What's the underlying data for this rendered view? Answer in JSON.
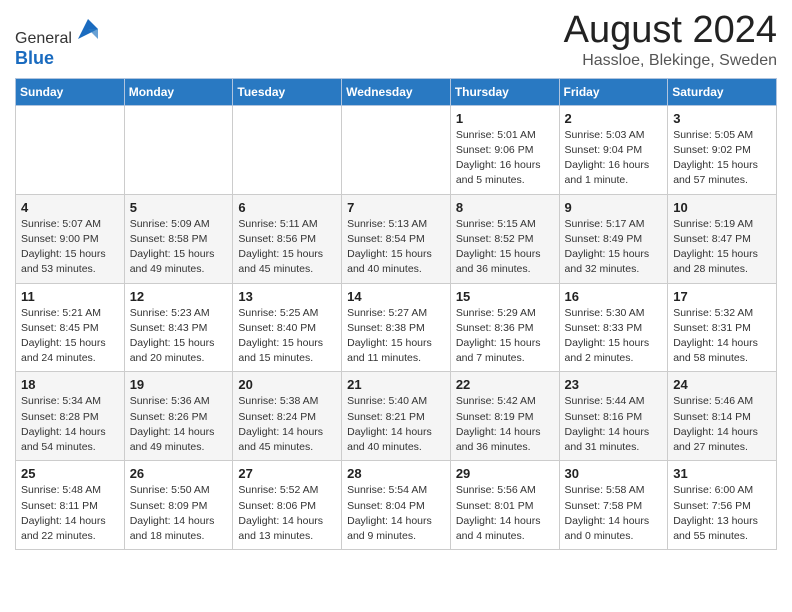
{
  "header": {
    "logo_line1": "General",
    "logo_line2": "Blue",
    "month_title": "August 2024",
    "location": "Hassloe, Blekinge, Sweden"
  },
  "weekdays": [
    "Sunday",
    "Monday",
    "Tuesday",
    "Wednesday",
    "Thursday",
    "Friday",
    "Saturday"
  ],
  "weeks": [
    [
      {
        "day": "",
        "info": ""
      },
      {
        "day": "",
        "info": ""
      },
      {
        "day": "",
        "info": ""
      },
      {
        "day": "",
        "info": ""
      },
      {
        "day": "1",
        "info": "Sunrise: 5:01 AM\nSunset: 9:06 PM\nDaylight: 16 hours\nand 5 minutes."
      },
      {
        "day": "2",
        "info": "Sunrise: 5:03 AM\nSunset: 9:04 PM\nDaylight: 16 hours\nand 1 minute."
      },
      {
        "day": "3",
        "info": "Sunrise: 5:05 AM\nSunset: 9:02 PM\nDaylight: 15 hours\nand 57 minutes."
      }
    ],
    [
      {
        "day": "4",
        "info": "Sunrise: 5:07 AM\nSunset: 9:00 PM\nDaylight: 15 hours\nand 53 minutes."
      },
      {
        "day": "5",
        "info": "Sunrise: 5:09 AM\nSunset: 8:58 PM\nDaylight: 15 hours\nand 49 minutes."
      },
      {
        "day": "6",
        "info": "Sunrise: 5:11 AM\nSunset: 8:56 PM\nDaylight: 15 hours\nand 45 minutes."
      },
      {
        "day": "7",
        "info": "Sunrise: 5:13 AM\nSunset: 8:54 PM\nDaylight: 15 hours\nand 40 minutes."
      },
      {
        "day": "8",
        "info": "Sunrise: 5:15 AM\nSunset: 8:52 PM\nDaylight: 15 hours\nand 36 minutes."
      },
      {
        "day": "9",
        "info": "Sunrise: 5:17 AM\nSunset: 8:49 PM\nDaylight: 15 hours\nand 32 minutes."
      },
      {
        "day": "10",
        "info": "Sunrise: 5:19 AM\nSunset: 8:47 PM\nDaylight: 15 hours\nand 28 minutes."
      }
    ],
    [
      {
        "day": "11",
        "info": "Sunrise: 5:21 AM\nSunset: 8:45 PM\nDaylight: 15 hours\nand 24 minutes."
      },
      {
        "day": "12",
        "info": "Sunrise: 5:23 AM\nSunset: 8:43 PM\nDaylight: 15 hours\nand 20 minutes."
      },
      {
        "day": "13",
        "info": "Sunrise: 5:25 AM\nSunset: 8:40 PM\nDaylight: 15 hours\nand 15 minutes."
      },
      {
        "day": "14",
        "info": "Sunrise: 5:27 AM\nSunset: 8:38 PM\nDaylight: 15 hours\nand 11 minutes."
      },
      {
        "day": "15",
        "info": "Sunrise: 5:29 AM\nSunset: 8:36 PM\nDaylight: 15 hours\nand 7 minutes."
      },
      {
        "day": "16",
        "info": "Sunrise: 5:30 AM\nSunset: 8:33 PM\nDaylight: 15 hours\nand 2 minutes."
      },
      {
        "day": "17",
        "info": "Sunrise: 5:32 AM\nSunset: 8:31 PM\nDaylight: 14 hours\nand 58 minutes."
      }
    ],
    [
      {
        "day": "18",
        "info": "Sunrise: 5:34 AM\nSunset: 8:28 PM\nDaylight: 14 hours\nand 54 minutes."
      },
      {
        "day": "19",
        "info": "Sunrise: 5:36 AM\nSunset: 8:26 PM\nDaylight: 14 hours\nand 49 minutes."
      },
      {
        "day": "20",
        "info": "Sunrise: 5:38 AM\nSunset: 8:24 PM\nDaylight: 14 hours\nand 45 minutes."
      },
      {
        "day": "21",
        "info": "Sunrise: 5:40 AM\nSunset: 8:21 PM\nDaylight: 14 hours\nand 40 minutes."
      },
      {
        "day": "22",
        "info": "Sunrise: 5:42 AM\nSunset: 8:19 PM\nDaylight: 14 hours\nand 36 minutes."
      },
      {
        "day": "23",
        "info": "Sunrise: 5:44 AM\nSunset: 8:16 PM\nDaylight: 14 hours\nand 31 minutes."
      },
      {
        "day": "24",
        "info": "Sunrise: 5:46 AM\nSunset: 8:14 PM\nDaylight: 14 hours\nand 27 minutes."
      }
    ],
    [
      {
        "day": "25",
        "info": "Sunrise: 5:48 AM\nSunset: 8:11 PM\nDaylight: 14 hours\nand 22 minutes."
      },
      {
        "day": "26",
        "info": "Sunrise: 5:50 AM\nSunset: 8:09 PM\nDaylight: 14 hours\nand 18 minutes."
      },
      {
        "day": "27",
        "info": "Sunrise: 5:52 AM\nSunset: 8:06 PM\nDaylight: 14 hours\nand 13 minutes."
      },
      {
        "day": "28",
        "info": "Sunrise: 5:54 AM\nSunset: 8:04 PM\nDaylight: 14 hours\nand 9 minutes."
      },
      {
        "day": "29",
        "info": "Sunrise: 5:56 AM\nSunset: 8:01 PM\nDaylight: 14 hours\nand 4 minutes."
      },
      {
        "day": "30",
        "info": "Sunrise: 5:58 AM\nSunset: 7:58 PM\nDaylight: 14 hours\nand 0 minutes."
      },
      {
        "day": "31",
        "info": "Sunrise: 6:00 AM\nSunset: 7:56 PM\nDaylight: 13 hours\nand 55 minutes."
      }
    ]
  ]
}
